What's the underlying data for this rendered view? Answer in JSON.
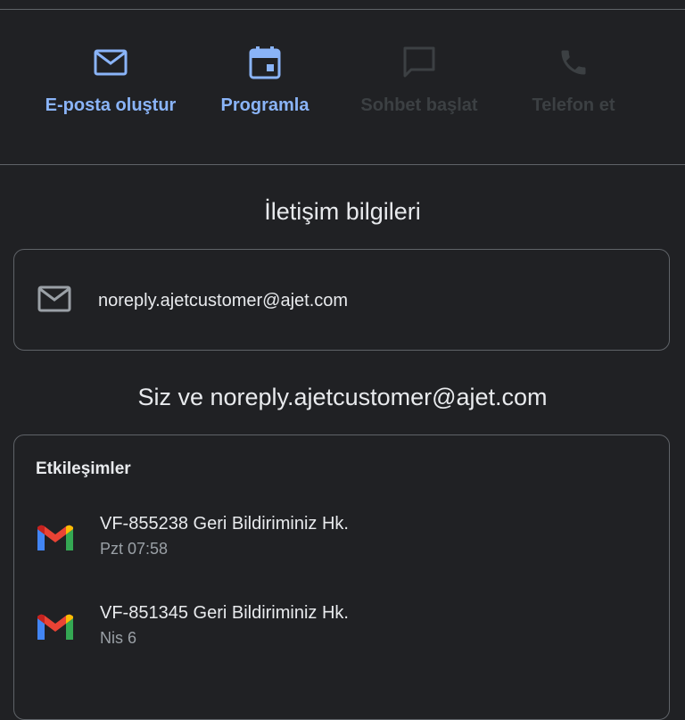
{
  "actions": [
    {
      "label": "E-posta oluştur",
      "icon": "mail-icon",
      "enabled": true
    },
    {
      "label": "Programla",
      "icon": "calendar-icon",
      "enabled": true
    },
    {
      "label": "Sohbet başlat",
      "icon": "chat-icon",
      "enabled": false
    },
    {
      "label": "Telefon et",
      "icon": "phone-icon",
      "enabled": false
    }
  ],
  "contact_info": {
    "title": "İletişim bilgileri",
    "email": "noreply.ajetcustomer@ajet.com"
  },
  "relation": {
    "title": "Siz ve noreply.ajetcustomer@ajet.com"
  },
  "interactions": {
    "heading": "Etkileşimler",
    "items": [
      {
        "subject": "VF-855238 Geri Bildiriminiz Hk.",
        "time": "Pzt 07:58",
        "icon": "gmail-icon"
      },
      {
        "subject": "VF-851345 Geri Bildiriminiz Hk.",
        "time": "Nis 6",
        "icon": "gmail-icon"
      }
    ]
  },
  "colors": {
    "background": "#202124",
    "accent": "#8ab4f8",
    "disabled": "#3c4043",
    "divider": "#5f6368"
  }
}
